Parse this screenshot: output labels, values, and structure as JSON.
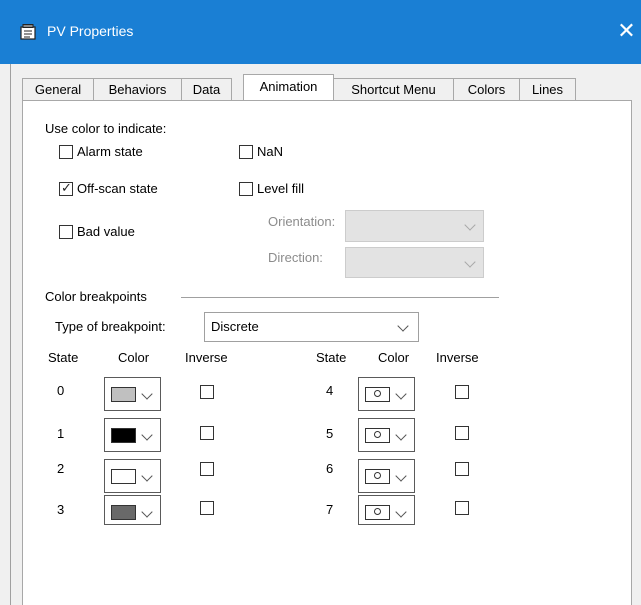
{
  "window": {
    "title": "PV Properties",
    "close_glyph": "✕"
  },
  "tabs": [
    {
      "label": "General"
    },
    {
      "label": "Behaviors"
    },
    {
      "label": "Data"
    },
    {
      "label": "Animation"
    },
    {
      "label": "Shortcut Menu"
    },
    {
      "label": "Colors"
    },
    {
      "label": "Lines"
    }
  ],
  "active_tab": "Animation",
  "color_indicate": {
    "heading": "Use color to indicate:",
    "alarm_state": {
      "label": "Alarm state",
      "checked": false
    },
    "nan": {
      "label": "NaN",
      "checked": false
    },
    "offscan_state": {
      "label": "Off-scan state",
      "checked": true
    },
    "level_fill": {
      "label": "Level fill",
      "checked": false
    },
    "bad_value": {
      "label": "Bad value",
      "checked": false
    },
    "orientation_label": "Orientation:",
    "direction_label": "Direction:"
  },
  "breakpoints": {
    "heading": "Color breakpoints",
    "type_label": "Type of breakpoint:",
    "type_value": "Discrete",
    "col_state": "State",
    "col_color": "Color",
    "col_inverse": "Inverse",
    "rows": [
      {
        "state": "0",
        "color": "#c0c0c0",
        "inverse": false
      },
      {
        "state": "1",
        "color": "#000000",
        "inverse": false
      },
      {
        "state": "2",
        "color": "#ffffff",
        "inverse": false
      },
      {
        "state": "3",
        "color": "#696969",
        "inverse": false
      },
      {
        "state": "4",
        "color": "none",
        "inverse": false
      },
      {
        "state": "5",
        "color": "none",
        "inverse": false
      },
      {
        "state": "6",
        "color": "none",
        "inverse": false
      },
      {
        "state": "7",
        "color": "none",
        "inverse": false
      }
    ]
  },
  "colors": {
    "titlebar": "#1a7fd4",
    "dialog_bg": "#f0f0f0",
    "panel_bg": "#ffffff"
  }
}
